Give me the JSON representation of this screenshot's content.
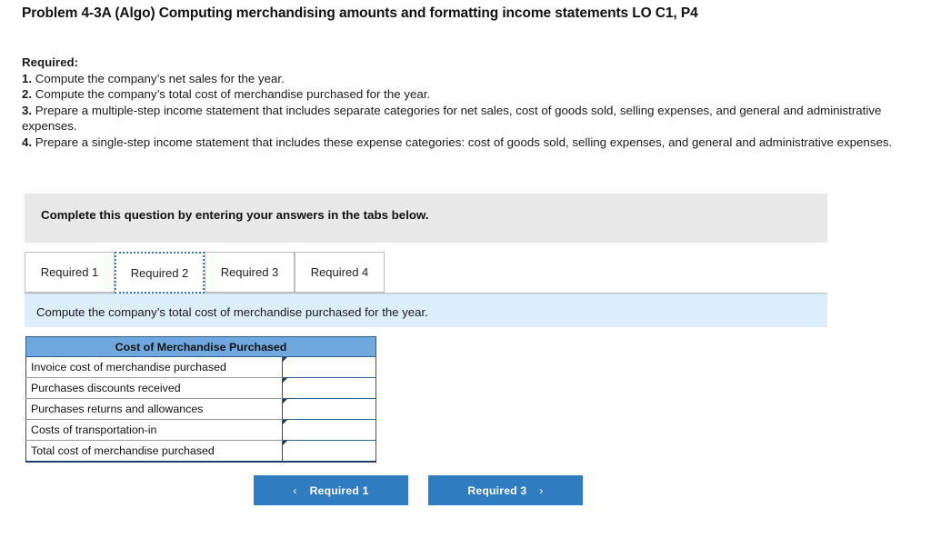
{
  "header": {
    "title": "Problem 4-3A (Algo) Computing merchandising amounts and formatting income statements LO C1, P4"
  },
  "required": {
    "heading": "Required:",
    "items": [
      {
        "num": "1.",
        "text": " Compute the company’s net sales for the year."
      },
      {
        "num": "2.",
        "text": " Compute the company’s total cost of merchandise purchased for the year."
      },
      {
        "num": "3.",
        "text": " Prepare a multiple-step income statement that includes separate categories for net sales, cost of goods sold, selling expenses, and general and administrative expenses."
      },
      {
        "num": "4.",
        "text": " Prepare a single-step income statement that includes these expense categories: cost of goods sold, selling expenses, and general and administrative expenses."
      }
    ]
  },
  "banner": {
    "text": "Complete this question by entering your answers in the tabs below."
  },
  "tabs": [
    {
      "label": "Required 1",
      "active": false
    },
    {
      "label": "Required 2",
      "active": true
    },
    {
      "label": "Required 3",
      "active": false
    },
    {
      "label": "Required 4",
      "active": false
    }
  ],
  "instruction": {
    "text": "Compute the company’s total cost of merchandise purchased for the year."
  },
  "table": {
    "header": "Cost of Merchandise Purchased",
    "rows": [
      {
        "label": "Invoice cost of merchandise purchased",
        "value": ""
      },
      {
        "label": "Purchases discounts received",
        "value": ""
      },
      {
        "label": "Purchases returns and allowances",
        "value": ""
      },
      {
        "label": "Costs of transportation-in",
        "value": ""
      },
      {
        "label": "Total cost of merchandise purchased",
        "value": ""
      }
    ]
  },
  "nav": {
    "prev_label": "Required 1",
    "next_label": "Required 3",
    "prev_icon": "chevron-left-icon",
    "next_icon": "chevron-right-icon",
    "prev_glyph": "‹",
    "next_glyph": "›"
  },
  "colors": {
    "accent": "#2f7dc0",
    "table_header": "#6fa8dc",
    "instruction_bg": "#ddeefb",
    "banner_bg": "#e8e8e8"
  }
}
